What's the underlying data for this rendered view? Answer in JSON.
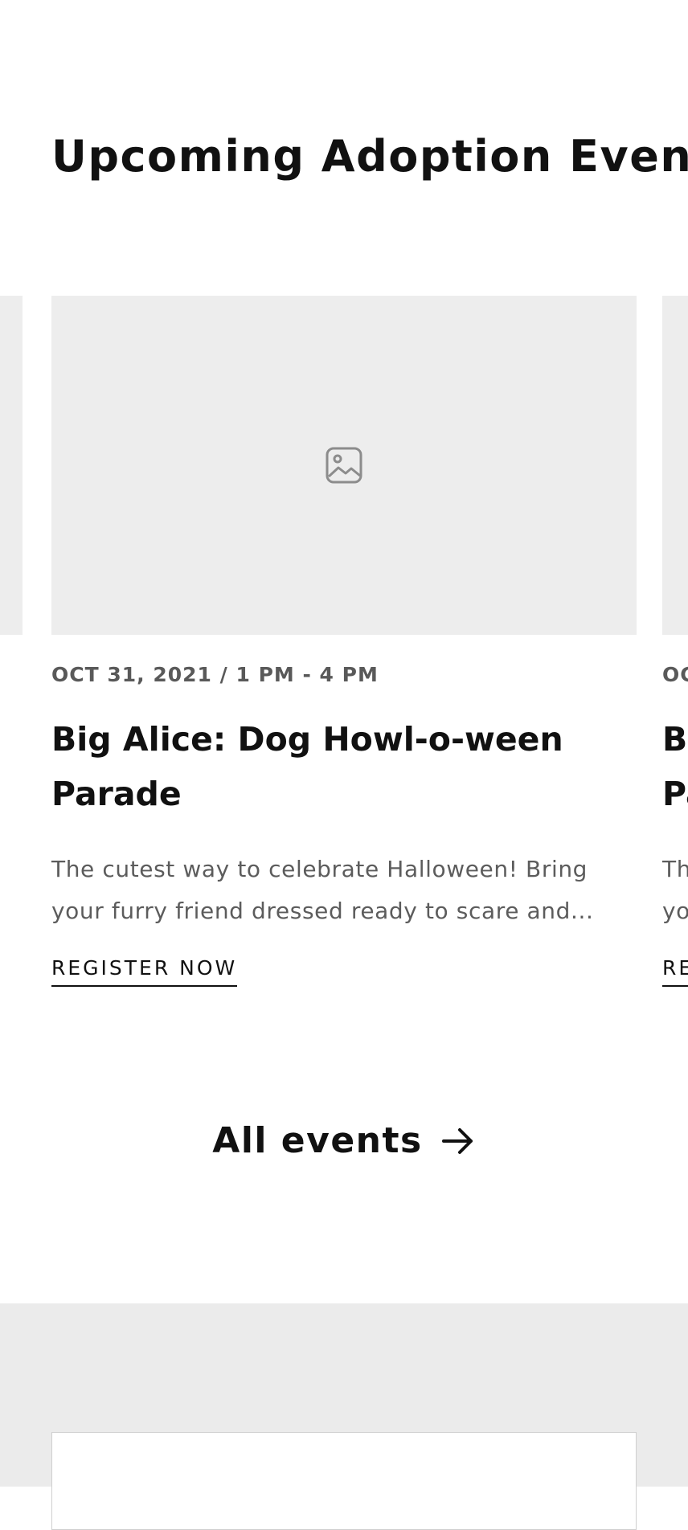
{
  "events_section": {
    "heading": "Upcoming Adoption Events",
    "all_events_label": "All events",
    "arrow_icon": "arrow-right-icon"
  },
  "events": [
    {
      "date": "OCT 31, 2021 / 1 PM - 4 PM",
      "title": "Big Alice: Dog Howl-o-ween Parade",
      "description": "The cutest way to celebrate Halloween! Bring your furry friend dressed ready to scare and...",
      "cta_label": "REGISTER NOW",
      "image_icon": "image-placeholder-icon"
    }
  ],
  "colors": {
    "image_placeholder_bg": "#ededed",
    "lower_section_bg": "#ebebeb",
    "date_text": "#595959",
    "description_text": "#5c5c5c"
  }
}
